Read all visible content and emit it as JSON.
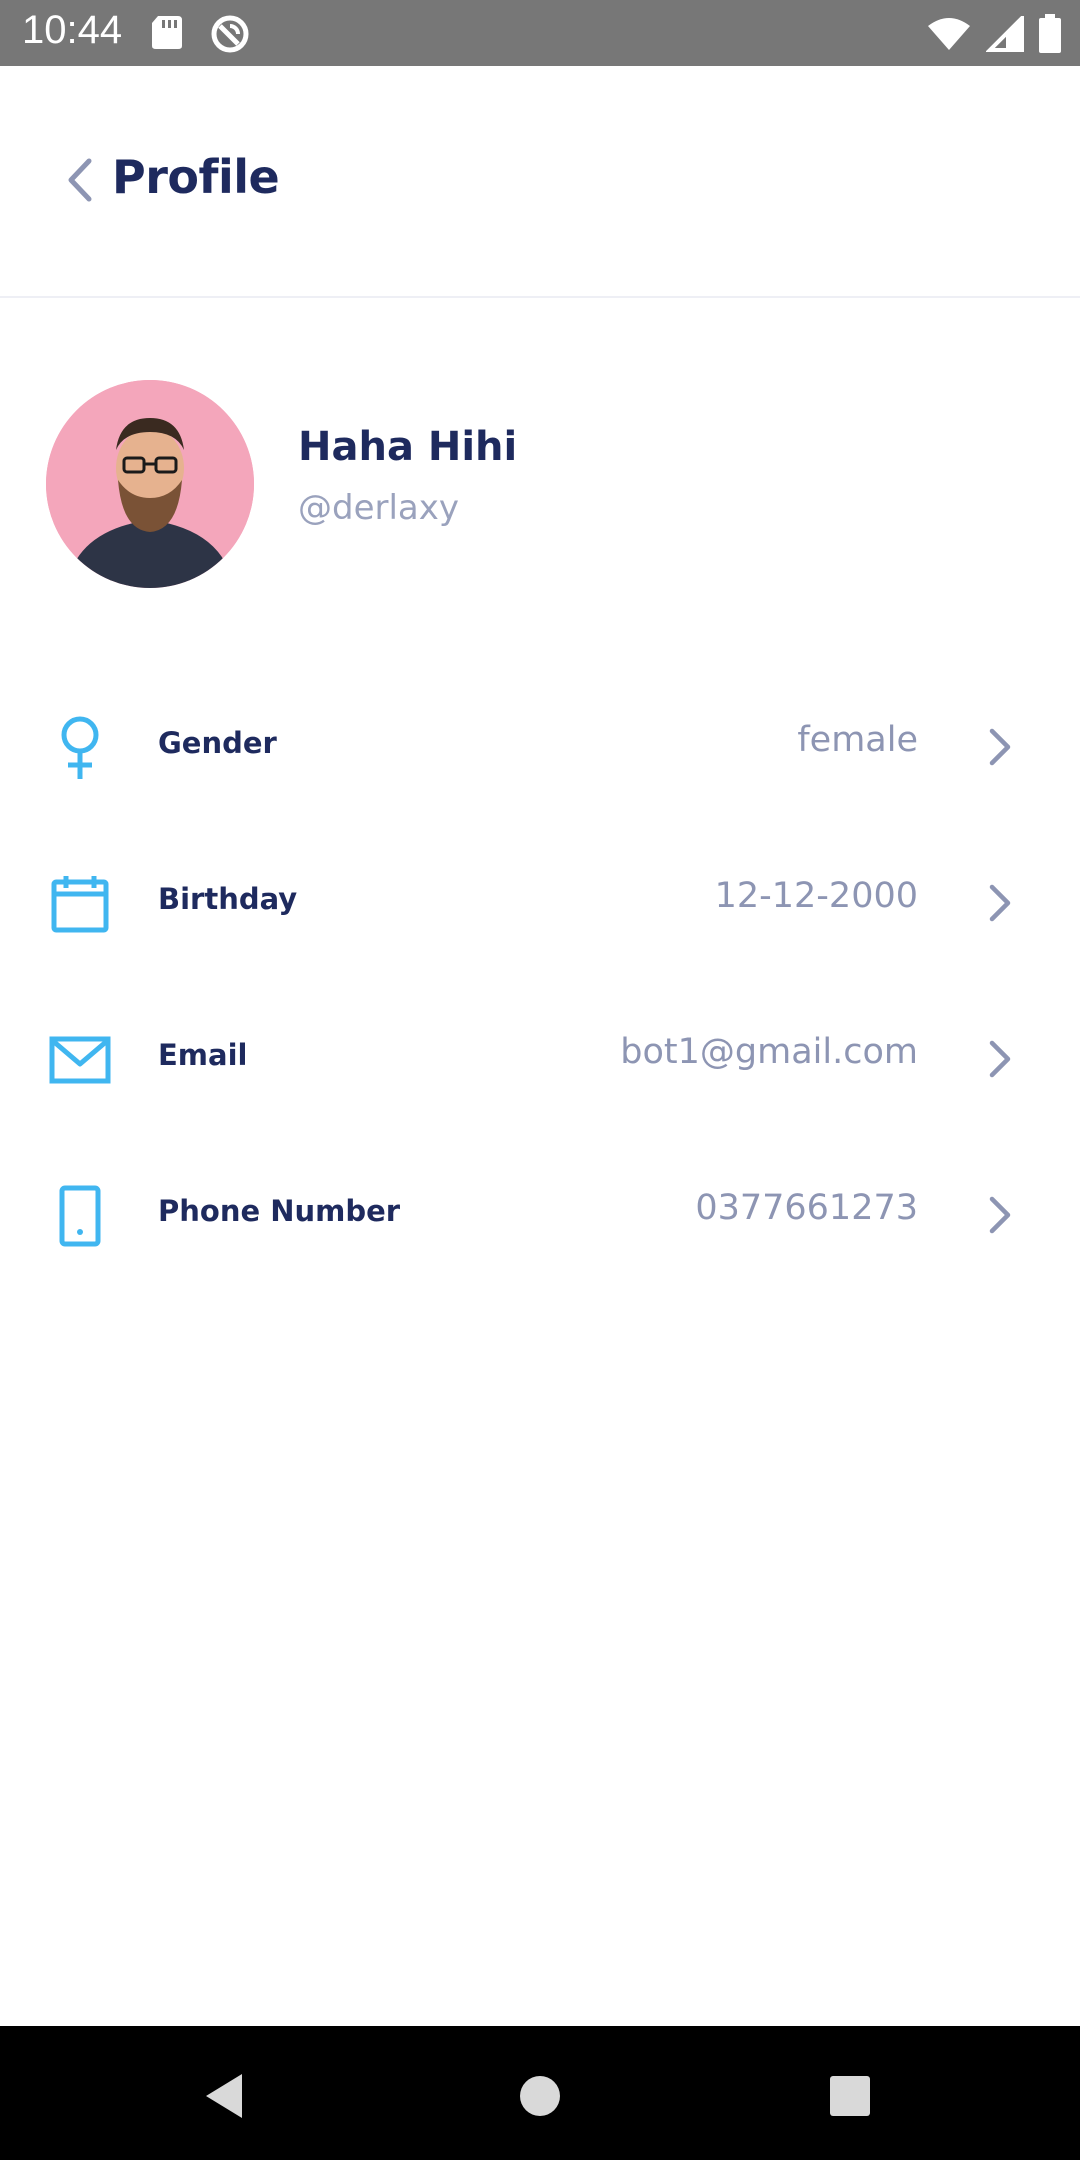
{
  "status_bar": {
    "time": "10:44",
    "left_icons": [
      "sd-card-icon",
      "do-not-disturb-icon"
    ],
    "right_icons": [
      "wifi-icon",
      "cellular-signal-icon",
      "battery-icon"
    ]
  },
  "header": {
    "title": "Profile",
    "back_icon": "chevron-left-icon"
  },
  "profile": {
    "name": "Haha Hihi",
    "username": "@derlaxy",
    "avatar_background": "#f4a6bb"
  },
  "rows": [
    {
      "label": "Gender",
      "value": "female",
      "icon": "female-icon"
    },
    {
      "label": "Birthday",
      "value": "12-12-2000",
      "icon": "calendar-icon"
    },
    {
      "label": "Email",
      "value": "bot1@gmail.com",
      "icon": "mail-icon"
    },
    {
      "label": "Phone Number",
      "value": "0377661273",
      "icon": "phone-icon"
    }
  ],
  "colors": {
    "title": "#1e2a5e",
    "accent_icon": "#40b6f0",
    "value_text": "#8d95b3",
    "chevron": "#8d95b3",
    "status_bar": "#777777",
    "nav_bar": "#000000"
  },
  "nav_bar": {
    "buttons": [
      "back-triangle-icon",
      "home-circle-icon",
      "recents-square-icon"
    ]
  }
}
